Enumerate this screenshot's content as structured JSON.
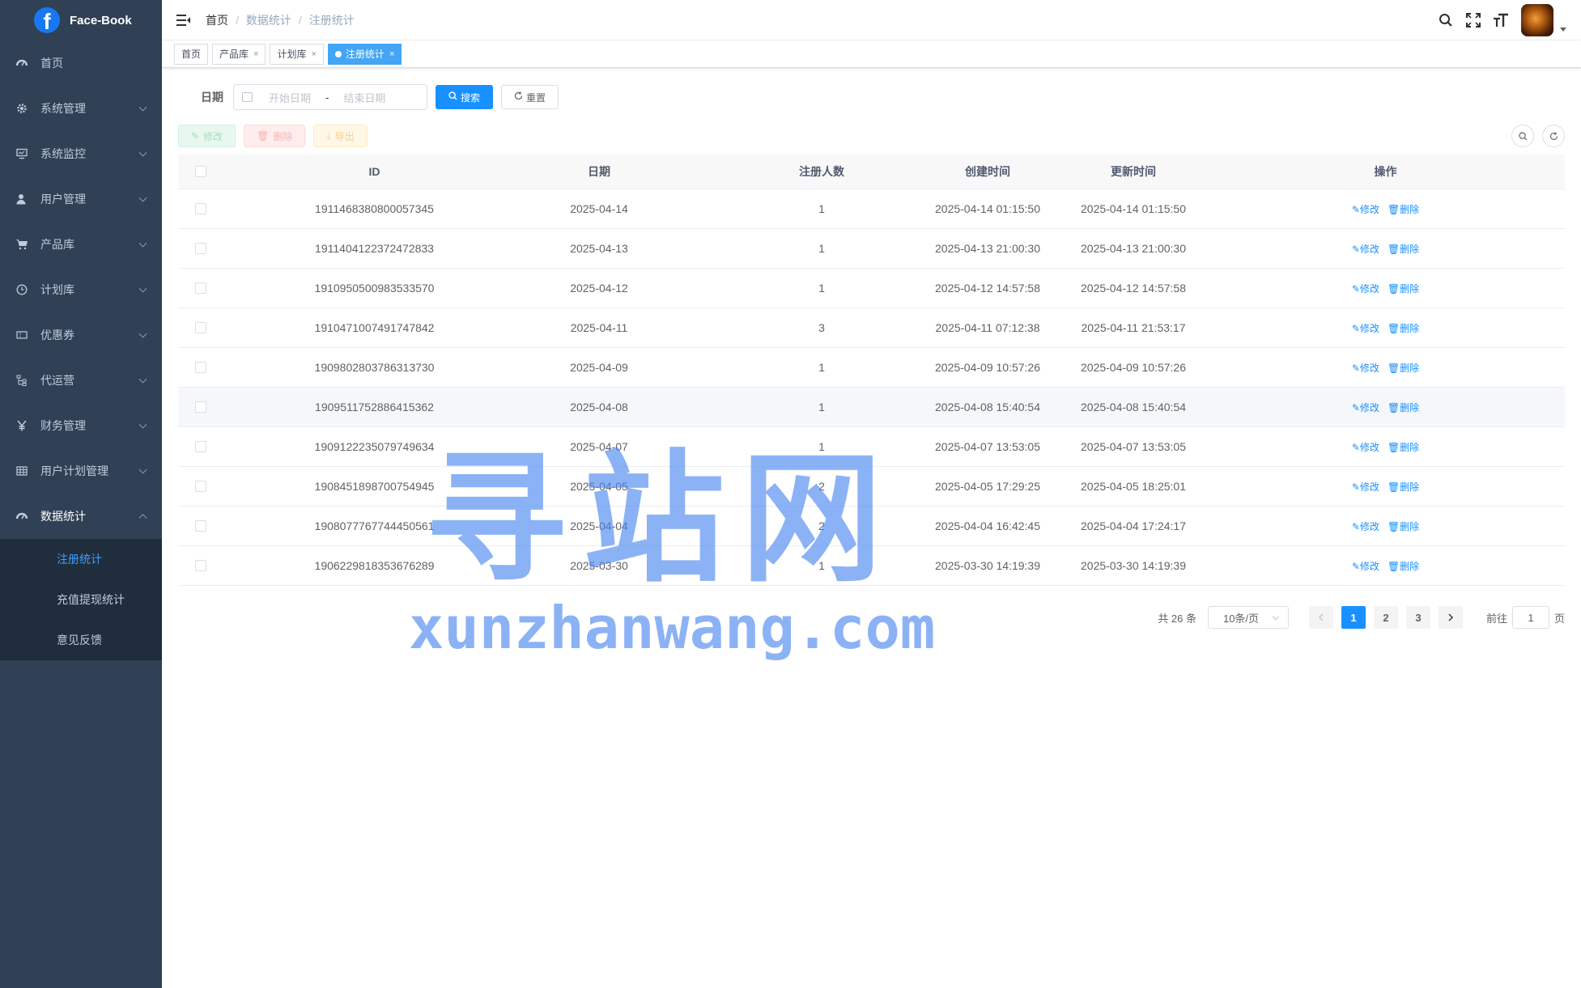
{
  "app": {
    "logo_letter": "f",
    "name": "Face-Book"
  },
  "sidebar": {
    "items": [
      {
        "label": "首页",
        "icon": "dashboard-icon"
      },
      {
        "label": "系统管理",
        "icon": "gear-icon"
      },
      {
        "label": "系统监控",
        "icon": "monitor-icon"
      },
      {
        "label": "用户管理",
        "icon": "user-icon"
      },
      {
        "label": "产品库",
        "icon": "cart-icon"
      },
      {
        "label": "计划库",
        "icon": "clock-icon"
      },
      {
        "label": "优惠券",
        "icon": "coupon-icon"
      },
      {
        "label": "代运营",
        "icon": "tree-icon"
      },
      {
        "label": "财务管理",
        "icon": "yen-icon"
      },
      {
        "label": "用户计划管理",
        "icon": "grid-icon"
      },
      {
        "label": "数据统计",
        "icon": "dashboard-icon"
      }
    ],
    "sub_items": [
      {
        "label": "注册统计",
        "active": true
      },
      {
        "label": "充值提现统计",
        "active": false
      },
      {
        "label": "意见反馈",
        "active": false
      }
    ]
  },
  "navbar": {
    "breadcrumb": [
      "首页",
      "数据统计",
      "注册统计"
    ]
  },
  "tags": [
    {
      "label": "首页",
      "closable": false,
      "active": false
    },
    {
      "label": "产品库",
      "closable": true,
      "active": false
    },
    {
      "label": "计划库",
      "closable": true,
      "active": false
    },
    {
      "label": "注册统计",
      "closable": true,
      "active": true
    }
  ],
  "search": {
    "date_label": "日期",
    "start_placeholder": "开始日期",
    "end_placeholder": "结束日期",
    "range_separator": "-",
    "search_btn": "搜索",
    "reset_btn": "重置"
  },
  "toolbar": {
    "edit": "修改",
    "delete": "删除",
    "export": "导出"
  },
  "table": {
    "columns": [
      "ID",
      "日期",
      "注册人数",
      "创建时间",
      "更新时间",
      "操作"
    ],
    "op_edit": "修改",
    "op_delete": "删除",
    "rows": [
      {
        "id": "1911468380800057345",
        "date": "2025-04-14",
        "count": "1",
        "created": "2025-04-14 01:15:50",
        "updated": "2025-04-14 01:15:50"
      },
      {
        "id": "1911404122372472833",
        "date": "2025-04-13",
        "count": "1",
        "created": "2025-04-13 21:00:30",
        "updated": "2025-04-13 21:00:30"
      },
      {
        "id": "1910950500983533570",
        "date": "2025-04-12",
        "count": "1",
        "created": "2025-04-12 14:57:58",
        "updated": "2025-04-12 14:57:58"
      },
      {
        "id": "1910471007491747842",
        "date": "2025-04-11",
        "count": "3",
        "created": "2025-04-11 07:12:38",
        "updated": "2025-04-11 21:53:17"
      },
      {
        "id": "1909802803786313730",
        "date": "2025-04-09",
        "count": "1",
        "created": "2025-04-09 10:57:26",
        "updated": "2025-04-09 10:57:26"
      },
      {
        "id": "1909511752886415362",
        "date": "2025-04-08",
        "count": "1",
        "created": "2025-04-08 15:40:54",
        "updated": "2025-04-08 15:40:54"
      },
      {
        "id": "1909122235079749634",
        "date": "2025-04-07",
        "count": "1",
        "created": "2025-04-07 13:53:05",
        "updated": "2025-04-07 13:53:05"
      },
      {
        "id": "1908451898700754945",
        "date": "2025-04-05",
        "count": "2",
        "created": "2025-04-05 17:29:25",
        "updated": "2025-04-05 18:25:01"
      },
      {
        "id": "1908077767744450561",
        "date": "2025-04-04",
        "count": "2",
        "created": "2025-04-04 16:42:45",
        "updated": "2025-04-04 17:24:17"
      },
      {
        "id": "1906229818353676289",
        "date": "2025-03-30",
        "count": "1",
        "created": "2025-03-30 14:19:39",
        "updated": "2025-03-30 14:19:39"
      }
    ]
  },
  "pagination": {
    "total": "共 26 条",
    "page_size": "10条/页",
    "pages": [
      "1",
      "2",
      "3"
    ],
    "current_page": "1",
    "goto_prefix": "前往",
    "goto_value": "1",
    "goto_suffix": "页"
  },
  "watermark": {
    "cn": "寻站网",
    "en": "xunzhanwang.com"
  },
  "colors": {
    "sidebar_bg": "#304156",
    "submenu_bg": "#1f2d3d",
    "primary": "#1890ff",
    "tag_active": "#42a5f5"
  }
}
